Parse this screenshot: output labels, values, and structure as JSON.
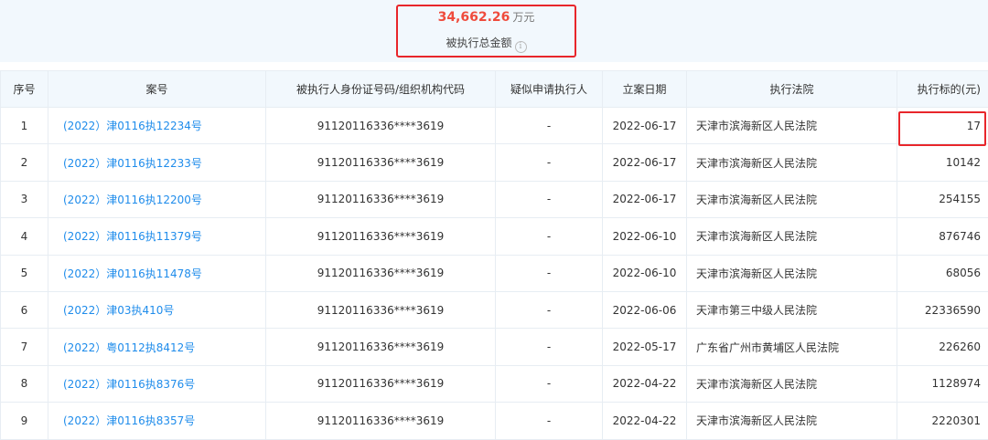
{
  "summary": {
    "amount": "34,662.26",
    "unit": "万元",
    "label": "被执行总金额",
    "info_glyph": "i"
  },
  "table": {
    "headers": [
      "序号",
      "案号",
      "被执行人身份证号码/组织机构代码",
      "疑似申请执行人",
      "立案日期",
      "执行法院",
      "执行标的(元)"
    ],
    "rows": [
      {
        "no": "1",
        "case": "(2022）津0116执12234号",
        "id": "91120116336****3619",
        "applicant": "-",
        "date": "2022-06-17",
        "court": "天津市滨海新区人民法院",
        "amount": "17"
      },
      {
        "no": "2",
        "case": "(2022）津0116执12233号",
        "id": "91120116336****3619",
        "applicant": "-",
        "date": "2022-06-17",
        "court": "天津市滨海新区人民法院",
        "amount": "10142"
      },
      {
        "no": "3",
        "case": "(2022）津0116执12200号",
        "id": "91120116336****3619",
        "applicant": "-",
        "date": "2022-06-17",
        "court": "天津市滨海新区人民法院",
        "amount": "254155"
      },
      {
        "no": "4",
        "case": "(2022）津0116执11379号",
        "id": "91120116336****3619",
        "applicant": "-",
        "date": "2022-06-10",
        "court": "天津市滨海新区人民法院",
        "amount": "876746"
      },
      {
        "no": "5",
        "case": "(2022）津0116执11478号",
        "id": "91120116336****3619",
        "applicant": "-",
        "date": "2022-06-10",
        "court": "天津市滨海新区人民法院",
        "amount": "68056"
      },
      {
        "no": "6",
        "case": "(2022）津03执410号",
        "id": "91120116336****3619",
        "applicant": "-",
        "date": "2022-06-06",
        "court": "天津市第三中级人民法院",
        "amount": "22336590"
      },
      {
        "no": "7",
        "case": "(2022）粤0112执8412号",
        "id": "91120116336****3619",
        "applicant": "-",
        "date": "2022-05-17",
        "court": "广东省广州市黄埔区人民法院",
        "amount": "226260"
      },
      {
        "no": "8",
        "case": "(2022）津0116执8376号",
        "id": "91120116336****3619",
        "applicant": "-",
        "date": "2022-04-22",
        "court": "天津市滨海新区人民法院",
        "amount": "1128974"
      },
      {
        "no": "9",
        "case": "(2022）津0116执8357号",
        "id": "91120116336****3619",
        "applicant": "-",
        "date": "2022-04-22",
        "court": "天津市滨海新区人民法院",
        "amount": "2220301"
      }
    ]
  },
  "colors": {
    "highlight_border": "#e8262b",
    "amount_text": "#ef4b3c",
    "link_text": "#1f8ceb",
    "header_bg": "#f2f8fd"
  }
}
